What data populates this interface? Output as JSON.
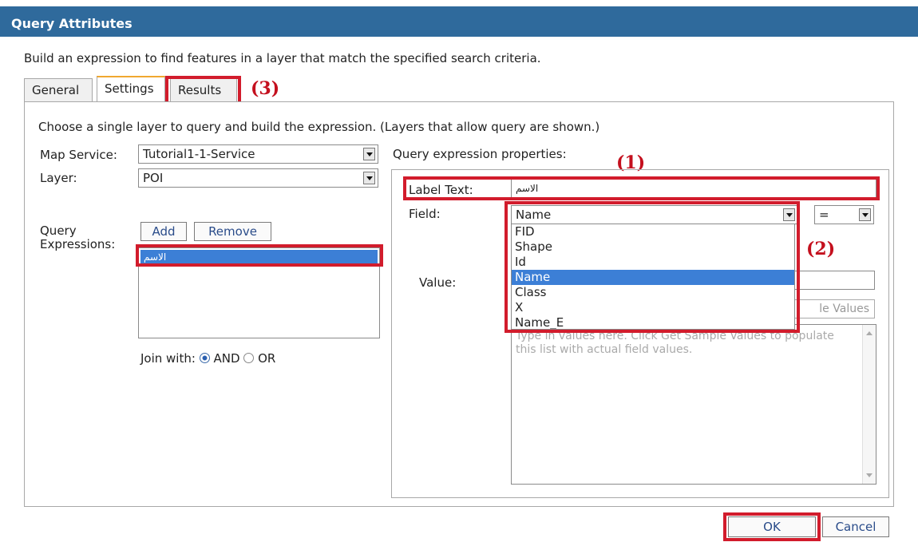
{
  "dialog": {
    "title": "Query Attributes",
    "description": "Build an expression to find features in a layer that match the specified search criteria."
  },
  "tabs": [
    {
      "label": "General"
    },
    {
      "label": "Settings"
    },
    {
      "label": "Results"
    }
  ],
  "annotations": {
    "one": "(1)",
    "two": "(2)",
    "three": "(3)"
  },
  "settings": {
    "instruction": "Choose a single layer to query and build the expression. (Layers that allow query are shown.)",
    "map_service_label": "Map Service:",
    "map_service_value": "Tutorial1-1-Service",
    "layer_label": "Layer:",
    "layer_value": "POI",
    "query_expressions_label_1": "Query",
    "query_expressions_label_2": "Expressions:",
    "add_label": "Add",
    "remove_label": "Remove",
    "expressions": [
      "الاسم"
    ],
    "join_label": "Join with:",
    "join_and": "AND",
    "join_or": "OR"
  },
  "properties": {
    "heading": "Query expression properties:",
    "label_text_label": "Label Text:",
    "label_text_value": "الاسم",
    "field_label": "Field:",
    "field_value": "Name",
    "field_options": [
      "FID",
      "Shape",
      "Id",
      "Name",
      "Class",
      "X",
      "Name_E"
    ],
    "operator_value": "=",
    "value_label": "Value:",
    "sample_values_partial": "le Values",
    "values_placeholder": "Type in values here. Click Get Sample Values to populate this list with actual field values."
  },
  "footer": {
    "ok_label": "OK",
    "cancel_label": "Cancel"
  },
  "colors": {
    "title_bar": "#2f6a9c",
    "highlight_red": "#d21c2c",
    "selection_blue": "#3c7fd6"
  }
}
